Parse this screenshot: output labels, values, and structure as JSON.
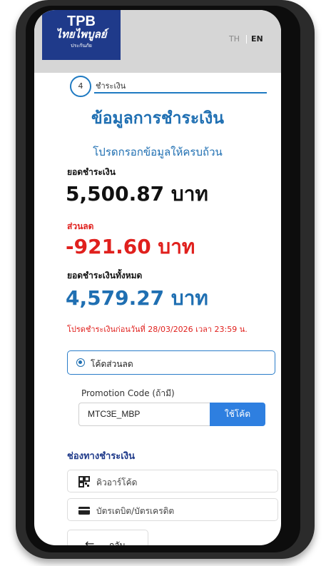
{
  "header": {
    "logo_line1": "TPB",
    "logo_line2": "ไทยไพบูลย์",
    "logo_line3": "ประกันภัย",
    "lang_th": "TH",
    "lang_en": "EN"
  },
  "step": {
    "number": "4",
    "label": "ชำระเงิน"
  },
  "title": "ข้อมูลการชำระเงิน",
  "subtitle": "โปรดกรอกข้อมูลให้ครบถ้วน",
  "payment": {
    "amount_label": "ยอดชำระเงิน",
    "amount_value": "5,500.87 บาท",
    "discount_label": "ส่วนลด",
    "discount_value": "-921.60 บาท",
    "total_label": "ยอดชำระเงินทั้งหมด",
    "total_value": "4,579.27 บาท",
    "deadline_note": "โปรดชำระเงินก่อนวันที่ 28/03/2026 เวลา 23:59 น."
  },
  "discount_code": {
    "radio_label": "โค้ดส่วนลด",
    "promo_label": "Promotion Code (ถ้ามี)",
    "promo_value": "MTC3E_MBP",
    "apply_button": "ใช้โค้ด"
  },
  "channels": {
    "title": "ช่องทางชำระเงิน",
    "items": [
      {
        "label": "คิวอาร์โค้ด",
        "icon": "qr-code-icon"
      },
      {
        "label": "บัตรเดบิต/บัตรเครดิต",
        "icon": "credit-card-icon"
      }
    ]
  },
  "back_button": {
    "label": "กลับ"
  },
  "colors": {
    "brand": "#1f3a8a",
    "accent": "#1f6fb2",
    "discount": "#e0201d",
    "button": "#2e7fe0"
  }
}
